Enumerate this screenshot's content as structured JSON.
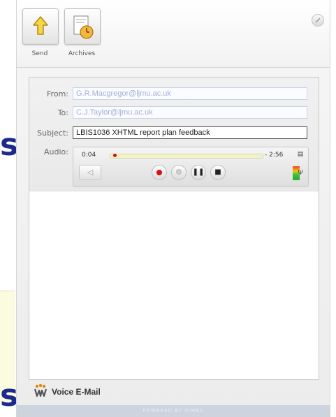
{
  "background": {
    "letters": [
      "s",
      "s"
    ]
  },
  "toolbar": {
    "send_label": "Send",
    "archives_label": "Archives"
  },
  "form": {
    "from_label": "From:",
    "from_value": "G.R.Macgregor@ljmu.ac.uk",
    "to_label": "To:",
    "to_value": "C.J.Taylor@ljmu.ac.uk",
    "subject_label": "Subject:",
    "subject_value": "LBIS1036 XHTML report plan feedback",
    "audio_label": "Audio:"
  },
  "audio": {
    "elapsed": "0:04",
    "remaining": "- 2:56",
    "progress_fraction": 0.02
  },
  "footer": {
    "title": "Voice E-Mail",
    "powered": "POWERED BY VIMBA"
  },
  "colors": {
    "accent_red": "#d41010",
    "slide_blue": "#1b2a8c"
  }
}
